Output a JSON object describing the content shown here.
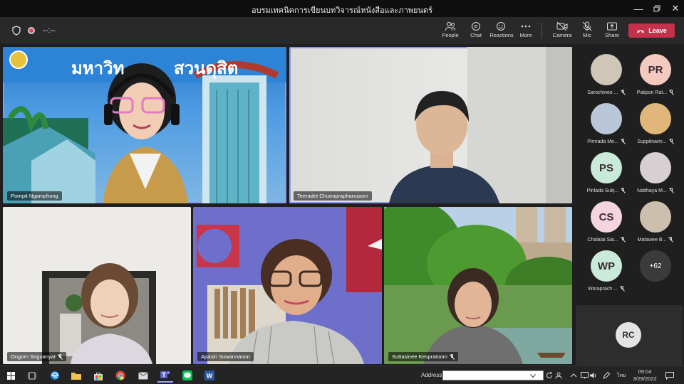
{
  "window": {
    "title": "อบรมเทคนิคการเขียนบทวิจารณ์หนังสือและภาพยนตร์"
  },
  "toolbar": {
    "timer": "--:--",
    "people_label": "People",
    "chat_label": "Chat",
    "reactions_label": "Reactions",
    "more_label": "More",
    "camera_label": "Camera",
    "mic_label": "Mic",
    "share_label": "Share",
    "leave_label": "Leave"
  },
  "videos": [
    {
      "name": "Pornpit Ngamphong",
      "banner": "มหาวิท",
      "banner2": "สวนดุสิต"
    },
    {
      "name": "Teeradet Chuenpraphanusorn"
    },
    {
      "name": "Ongorn Snguanyat"
    },
    {
      "name": "Apasiri Suwannanon"
    },
    {
      "name": "Suttasinee Kespratoom"
    }
  ],
  "roster": {
    "people": [
      {
        "name": "Sarochinee ...",
        "initials": "",
        "color": "#cfc6b8"
      },
      {
        "name": "Patipon Rat...",
        "initials": "PR",
        "color": "#f4c9c0"
      },
      {
        "name": "Pimrada Me...",
        "initials": "",
        "color": "#b9c7d9"
      },
      {
        "name": "Suppitnarin...",
        "initials": "",
        "color": "#e0b67a"
      },
      {
        "name": "Pinlada Sukj...",
        "initials": "PS",
        "color": "#c9ead9"
      },
      {
        "name": "Natthaya M...",
        "initials": "",
        "color": "#d8cfd2"
      },
      {
        "name": "Chalalai Sai...",
        "initials": "CS",
        "color": "#f4d4de"
      },
      {
        "name": "Matawee B...",
        "initials": "",
        "color": "#cdbfae"
      },
      {
        "name": "Woraprach ...",
        "initials": "WP",
        "color": "#c9ead9"
      },
      {
        "name": "",
        "initials": "+62",
        "color": "#3b3b3b"
      }
    ],
    "overflow_card": {
      "initials": "RC"
    }
  },
  "taskbar": {
    "address_label": "Address",
    "lang": "ไทย",
    "time": "09:04",
    "date": "3/29/2022"
  }
}
